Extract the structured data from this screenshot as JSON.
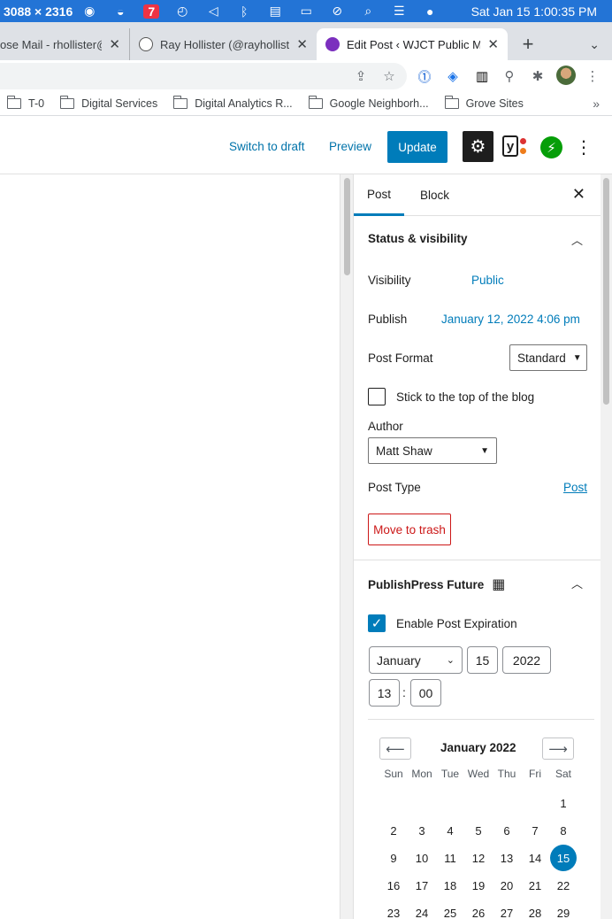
{
  "menubar": {
    "resolution": "3088 × 2316",
    "clock": "Sat Jan 15  1:00:35 PM"
  },
  "tabs": [
    {
      "title": "ose Mail - rhollister@",
      "close": "✕"
    },
    {
      "title": "Ray Hollister (@rayhollister",
      "close": "✕"
    },
    {
      "title": "Edit Post ‹ WJCT Public M",
      "close": "✕"
    }
  ],
  "newtab": "+",
  "bookmarks": [
    {
      "label": "T-0"
    },
    {
      "label": "Digital Services"
    },
    {
      "label": "Digital Analytics R..."
    },
    {
      "label": "Google Neighborh..."
    },
    {
      "label": "Grove Sites"
    }
  ],
  "bookmarks_more": "»",
  "header": {
    "switch_to_draft": "Switch to draft",
    "preview": "Preview",
    "update": "Update",
    "yoast_letter": "y"
  },
  "sidebar": {
    "tab_post": "Post",
    "tab_block": "Block",
    "close": "✕",
    "status_title": "Status & visibility",
    "visibility_label": "Visibility",
    "visibility_value": "Public",
    "publish_label": "Publish",
    "publish_value": "January 12, 2022 4:06 pm",
    "post_format_label": "Post Format",
    "post_format_value": "Standard",
    "sticky_label": "Stick to the top of the blog",
    "author_label": "Author",
    "author_value": "Matt Shaw",
    "post_type_label": "Post Type",
    "post_type_value": "Post",
    "trash_label": "Move to trash",
    "ppf_title": "PublishPress Future",
    "expiration_label": "Enable Post Expiration",
    "exp_month": "January",
    "exp_day": "15",
    "exp_year": "2022",
    "exp_hour": "13",
    "exp_minute": "00",
    "time_sep": ":"
  },
  "calendar": {
    "month_label": "January 2022",
    "prev": "⟵",
    "next": "⟶",
    "weekdays": [
      "Sun",
      "Mon",
      "Tue",
      "Wed",
      "Thu",
      "Fri",
      "Sat"
    ],
    "weeks": [
      [
        "",
        "",
        "",
        "",
        "",
        "",
        "1"
      ],
      [
        "2",
        "3",
        "4",
        "5",
        "6",
        "7",
        "8"
      ],
      [
        "9",
        "10",
        "11",
        "12",
        "13",
        "14",
        "15"
      ],
      [
        "16",
        "17",
        "18",
        "19",
        "20",
        "21",
        "22"
      ],
      [
        "23",
        "24",
        "25",
        "26",
        "27",
        "28",
        "29"
      ]
    ],
    "selected": "15"
  },
  "colors": {
    "menubar": "#2374d6",
    "accent": "#007cba",
    "danger": "#cc1818",
    "jetpack": "#069e08"
  }
}
